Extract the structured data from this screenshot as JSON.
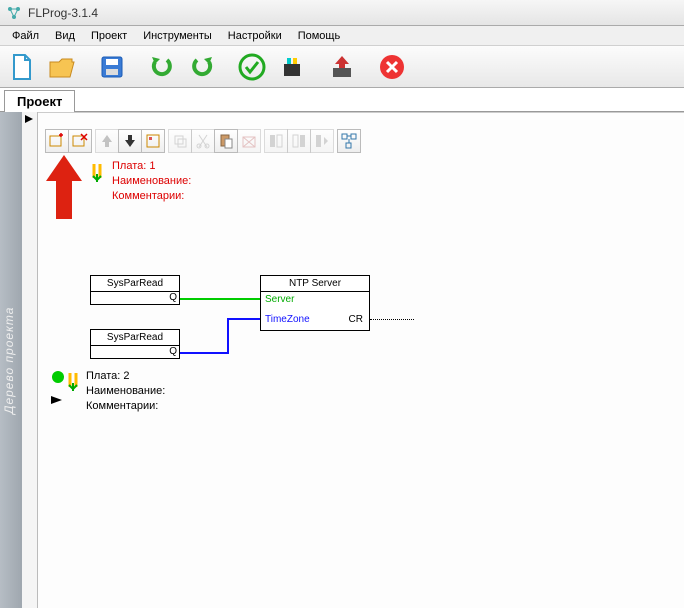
{
  "window": {
    "title": "FLProg-3.1.4"
  },
  "menu": {
    "file": "Файл",
    "view": "Вид",
    "project": "Проект",
    "tools": "Инструменты",
    "settings": "Настройки",
    "help": "Помощь"
  },
  "tab": {
    "project": "Проект"
  },
  "sidebar": {
    "tree_label": "Дерево проекта"
  },
  "board1": {
    "plate": "Плата: 1",
    "name": "Наименование:",
    "comments": "Комментарии:"
  },
  "board2": {
    "plate": "Плата: 2",
    "name": "Наименование:",
    "comments": "Комментарии:"
  },
  "blocks": {
    "syspar1": "SysParRead",
    "syspar2": "SysParRead",
    "ntp_title": "NTP Server",
    "ntp_server_pin": "Server",
    "ntp_tz_pin": "TimeZone",
    "ntp_cr_pin": "CR",
    "q": "Q"
  }
}
